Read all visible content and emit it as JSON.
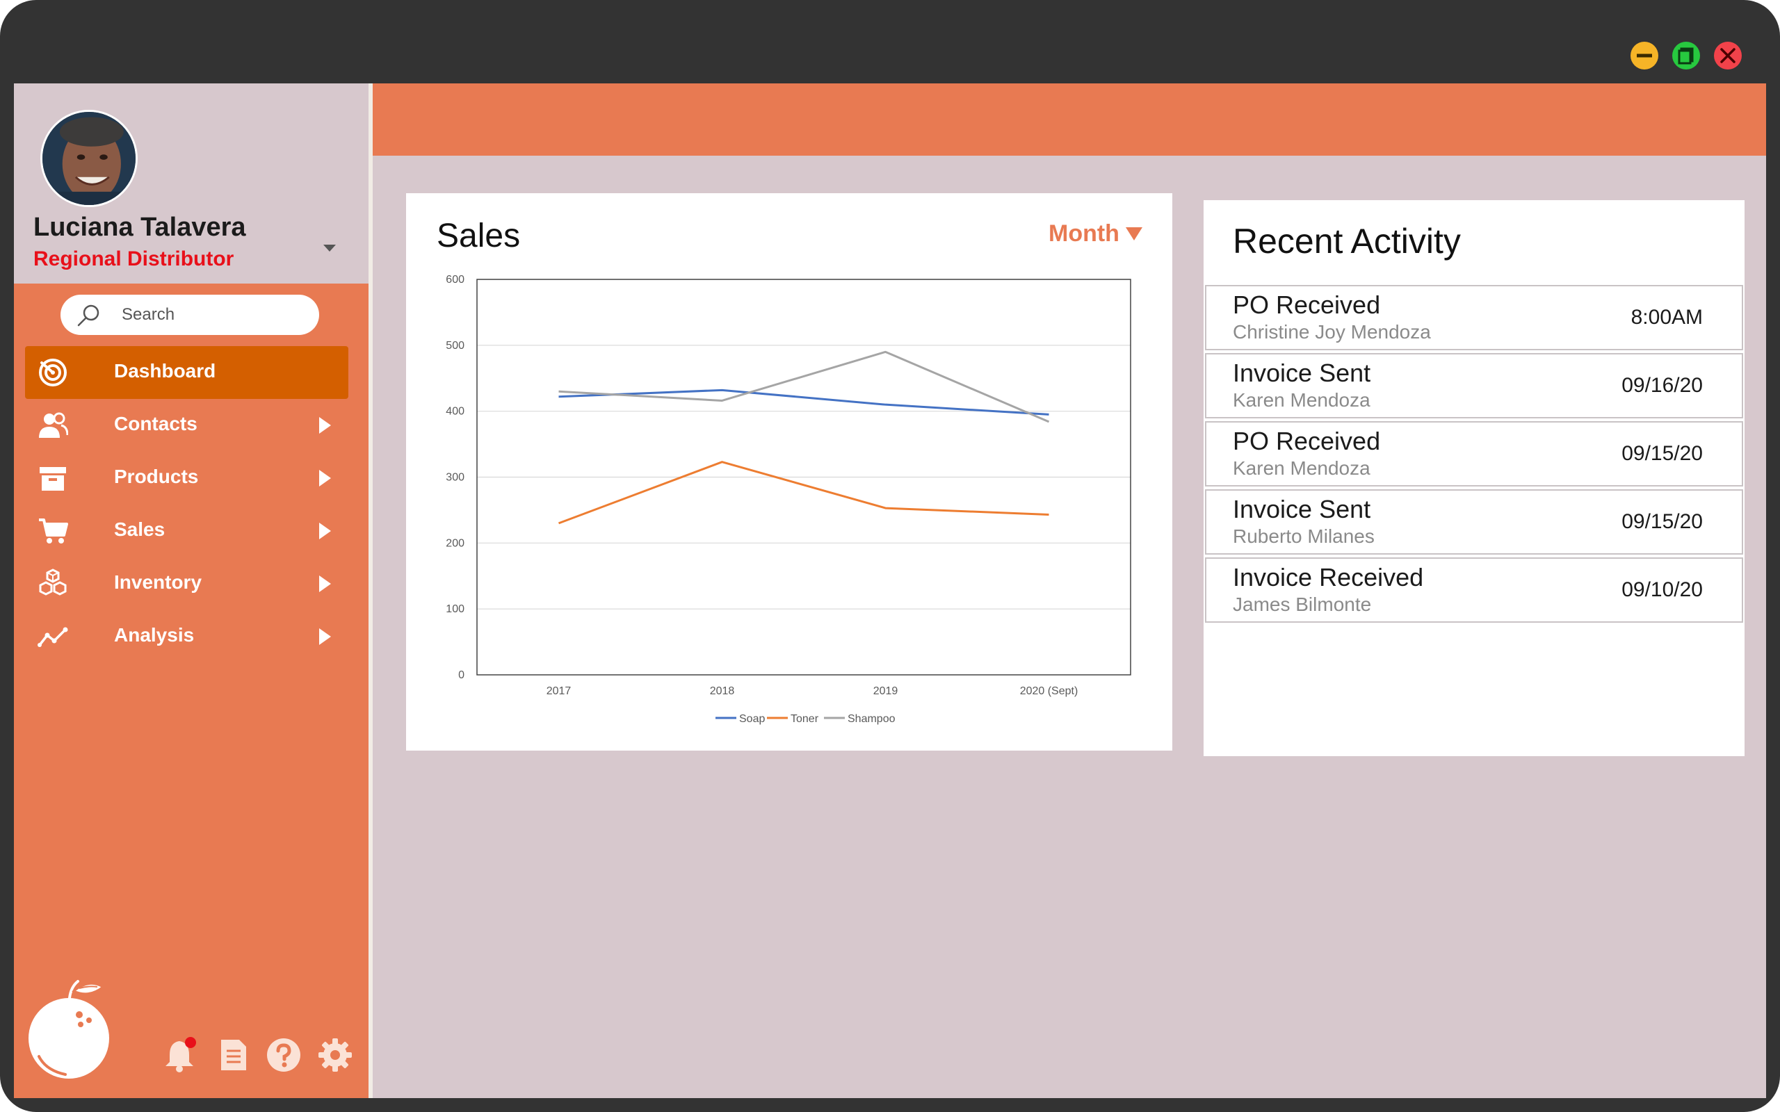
{
  "window": {
    "controls": [
      "minimize-icon",
      "maximize-icon",
      "close-icon"
    ],
    "colors": {
      "minimize": "#f6b427",
      "maximize": "#27c93f",
      "close": "#f2424a"
    }
  },
  "profile": {
    "name": "Luciana Talavera",
    "role": "Regional Distributor"
  },
  "search": {
    "placeholder": "Search"
  },
  "sidebar": {
    "items": [
      {
        "label": "Dashboard",
        "icon": "radar-icon",
        "active": true
      },
      {
        "label": "Contacts",
        "icon": "users-icon"
      },
      {
        "label": "Products",
        "icon": "box-icon"
      },
      {
        "label": "Sales",
        "icon": "cart-icon"
      },
      {
        "label": "Inventory",
        "icon": "cubes-icon"
      },
      {
        "label": "Analysis",
        "icon": "trend-icon"
      }
    ],
    "footer_icons": [
      "bell-icon",
      "document-icon",
      "help-icon",
      "gear-icon"
    ]
  },
  "colors": {
    "accent": "#e87a52",
    "active_nav": "#d45f00",
    "role_text": "#e8101a",
    "background": "#d7c8cd"
  },
  "sales": {
    "title": "Sales",
    "period_label": "Month"
  },
  "chart_data": {
    "type": "line",
    "categories": [
      "2017",
      "2018",
      "2019",
      "2020 (Sept)"
    ],
    "series": [
      {
        "name": "Soap",
        "color": "#4472c4",
        "values": [
          422,
          432,
          410,
          395
        ]
      },
      {
        "name": "Toner",
        "color": "#ed7d31",
        "values": [
          230,
          323,
          253,
          243
        ]
      },
      {
        "name": "Shampoo",
        "color": "#a5a5a5",
        "values": [
          430,
          416,
          490,
          384
        ]
      }
    ],
    "yticks": [
      "0",
      "100",
      "200",
      "300",
      "400",
      "500",
      "600"
    ],
    "ylim": [
      0,
      600
    ],
    "grid": true,
    "legend": "bottom"
  },
  "activity": {
    "title": "Recent Activity",
    "items": [
      {
        "title": "PO Received",
        "name": "Christine Joy Mendoza",
        "date": "8:00AM"
      },
      {
        "title": "Invoice Sent",
        "name": "Karen Mendoza",
        "date": "09/16/20"
      },
      {
        "title": "PO Received",
        "name": "Karen Mendoza",
        "date": "09/15/20"
      },
      {
        "title": "Invoice Sent",
        "name": "Ruberto Milanes",
        "date": "09/15/20"
      },
      {
        "title": "Invoice Received",
        "name": "James Bilmonte",
        "date": "09/10/20"
      }
    ]
  }
}
